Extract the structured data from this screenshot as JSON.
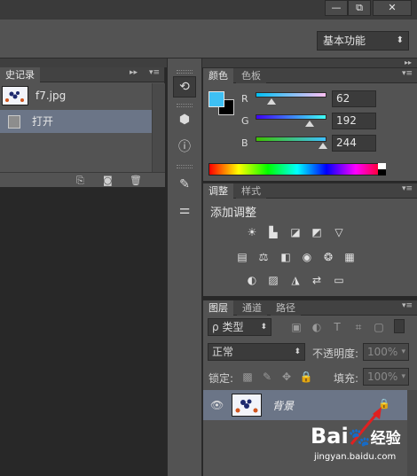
{
  "window": {
    "minimize_label": "—",
    "restore_label": "⧉",
    "close_label": "✕"
  },
  "options_bar": {
    "workspace_value": "基本功能",
    "workspace_arrow": "⬍"
  },
  "history_panel": {
    "tab_label": "史记录",
    "collapse_glyph": "▸▸",
    "menu_glyph": "▾≡",
    "snapshot_name": "f7.jpg",
    "items": [
      {
        "label": "打开",
        "selected": true
      }
    ],
    "footer_icons": [
      "new-document-from-state-icon",
      "camera-icon",
      "trash-icon"
    ]
  },
  "color_panel": {
    "tabs": [
      "颜色",
      "色板"
    ],
    "foreground_color": "#3ec0f4",
    "background_color": "#000000",
    "channels": [
      {
        "name": "R",
        "value": "62"
      },
      {
        "name": "G",
        "value": "192"
      },
      {
        "name": "B",
        "value": "244"
      }
    ]
  },
  "adjustments_panel": {
    "tabs": [
      "调整",
      "样式"
    ],
    "heading": "添加调整",
    "row1_icons": [
      "brightness-contrast-icon",
      "levels-icon",
      "curves-icon",
      "exposure-icon",
      "vibrance-icon"
    ],
    "row2_icons": [
      "hue-saturation-icon",
      "color-balance-icon",
      "black-white-icon",
      "photo-filter-icon",
      "channel-mixer-icon",
      "color-lookup-icon"
    ],
    "row3_icons": [
      "invert-icon",
      "posterize-icon",
      "threshold-icon",
      "selective-color-icon",
      "gradient-map-icon"
    ]
  },
  "layers_panel": {
    "tabs": [
      "图层",
      "通道",
      "路径"
    ],
    "filter_kind_value": "类型",
    "filter_search_glyph": "ρ",
    "blend_mode_value": "正常",
    "opacity_label": "不透明度:",
    "opacity_value": "100%",
    "lock_label": "锁定:",
    "fill_label": "填充:",
    "fill_value": "100%",
    "layers": [
      {
        "name": "背景",
        "visible": true,
        "locked": true
      }
    ]
  },
  "watermark": {
    "brand": "Bai",
    "brand_tail": "经验",
    "url": "jingyan.baidu.com"
  },
  "colors": {
    "panel_bg": "#535353",
    "selected_row": "#6b7587",
    "app_bg": "#282828",
    "annotation_arrow": "#e02020"
  }
}
